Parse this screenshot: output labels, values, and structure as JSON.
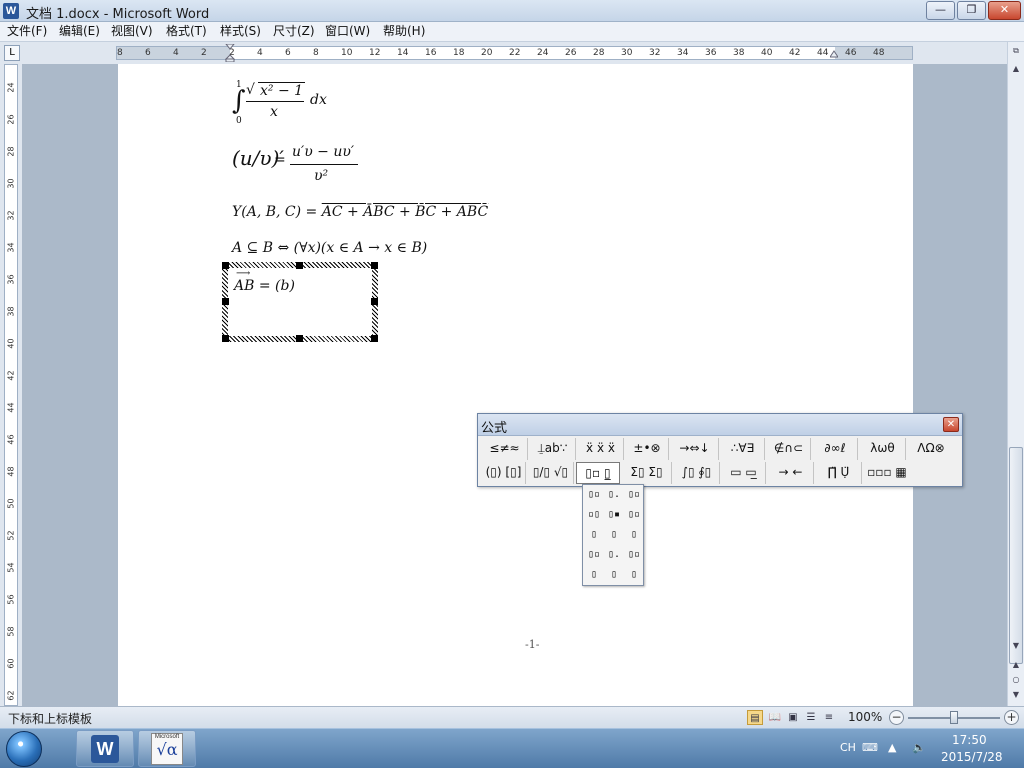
{
  "window": {
    "title": "文档 1.docx - Microsoft Word",
    "app_icon": "W",
    "minimize": "—",
    "maximize": "❐",
    "close": "✕"
  },
  "menu": [
    {
      "id": "file",
      "label": "文件(F)"
    },
    {
      "id": "edit",
      "label": "编辑(E)"
    },
    {
      "id": "view",
      "label": "视图(V)"
    },
    {
      "id": "format",
      "label": "格式(T)"
    },
    {
      "id": "style",
      "label": "样式(S)"
    },
    {
      "id": "size",
      "label": "尺寸(Z)"
    },
    {
      "id": "window",
      "label": "窗口(W)"
    },
    {
      "id": "help",
      "label": "帮助(H)"
    }
  ],
  "ruler": {
    "corner": "L",
    "h_ticks": [
      "8",
      "6",
      "4",
      "2",
      "2",
      "4",
      "6",
      "8",
      "10",
      "12",
      "14",
      "16",
      "18",
      "20",
      "22",
      "24",
      "26",
      "28",
      "30",
      "32",
      "34",
      "36",
      "38",
      "40",
      "42",
      "44",
      "46",
      "48"
    ],
    "v_ticks": [
      "24",
      "26",
      "28",
      "30",
      "32",
      "34",
      "36",
      "38",
      "40",
      "42",
      "44",
      "46",
      "48",
      "50",
      "52",
      "54",
      "56",
      "58",
      "60",
      "62"
    ]
  },
  "document": {
    "equations": {
      "integral": {
        "upper": "1",
        "lower": "0",
        "numerator": "x² − 1",
        "denominator": "x",
        "tail": "dx"
      },
      "derivative": {
        "left": "(u/υ)′",
        "equals": "=",
        "numerator": "u′υ − uυ′",
        "denominator": "υ²"
      },
      "boolean": {
        "lhs": "Y(A, B, C) =",
        "rhs": "AC + ĀBC + B̄C + ABC̄"
      },
      "set": {
        "text": "A ⊆ B ⇔ (∀x)(x ∈ A → x ∈ B)"
      },
      "vector": {
        "text": "AB = (b)"
      }
    },
    "page_number": "-1-"
  },
  "equation_toolbar": {
    "title": "公式",
    "close": "✕",
    "row1": [
      {
        "id": "relations",
        "label": "≤≠≈"
      },
      {
        "id": "spaces",
        "label": "⍊ab∵"
      },
      {
        "id": "embellish",
        "label": "ẍ ẍ ẍ"
      },
      {
        "id": "operators",
        "label": "±•⊗"
      },
      {
        "id": "arrows",
        "label": "→⇔↓"
      },
      {
        "id": "logic",
        "label": "∴∀∃"
      },
      {
        "id": "sets",
        "label": "∉∩⊂"
      },
      {
        "id": "misc",
        "label": "∂∞ℓ"
      },
      {
        "id": "greek-lower",
        "label": "λωθ"
      },
      {
        "id": "greek-upper",
        "label": "ΛΩ⊗"
      }
    ],
    "row2": [
      {
        "id": "fences",
        "label": "(▯) [▯]"
      },
      {
        "id": "fractions",
        "label": "▯/▯ √▯"
      },
      {
        "id": "scripts",
        "label": "▯▫ ▯̲"
      },
      {
        "id": "sums",
        "label": "Σ▯ Σ▯"
      },
      {
        "id": "integrals",
        "label": "∫▯ ∮▯"
      },
      {
        "id": "bars",
        "label": "▭ ▭̲"
      },
      {
        "id": "labeled-arrows",
        "label": "→ ←"
      },
      {
        "id": "products",
        "label": "∏̈ Ụ̈"
      },
      {
        "id": "matrices",
        "label": "▫▫▫ ▦"
      }
    ]
  },
  "palette": {
    "items": [
      "▯▫",
      "▯.",
      "▯▫",
      "▫▯",
      "▯▪",
      "▯▫",
      "▯",
      "▯",
      "▯",
      "▯▫",
      "▯.",
      "▯▫",
      "▯",
      "▯",
      "▯"
    ]
  },
  "status": {
    "text": "下标和上标模板",
    "zoom": "100%",
    "zoom_minus": "−",
    "zoom_plus": "+"
  },
  "taskbar": {
    "word_icon": "W",
    "mathtype_icon_label": "Microsoft",
    "mathtype_icon_symbol": "√α",
    "input_method": "CH",
    "time": "17:50",
    "date": "2015/7/28"
  }
}
